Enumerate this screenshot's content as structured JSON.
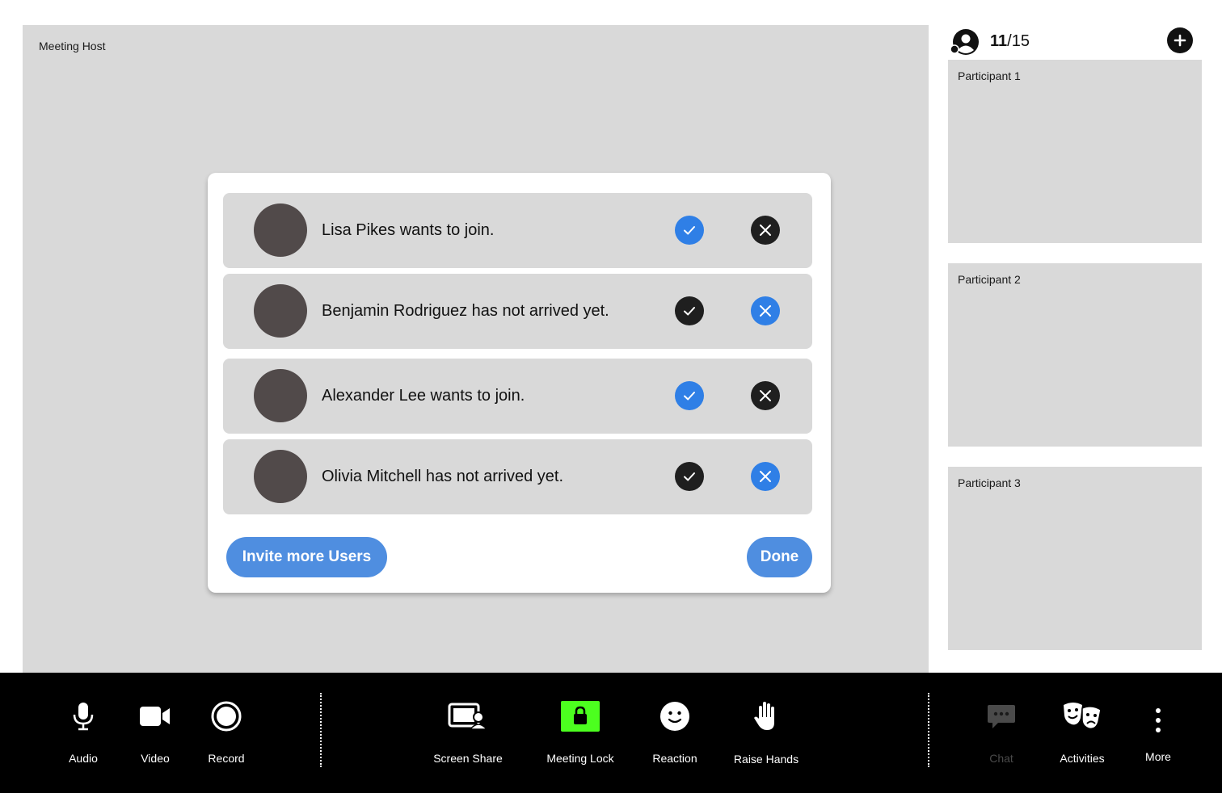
{
  "stage": {
    "host_label": "Meeting Host"
  },
  "requests": [
    {
      "text": "Lisa Pikes wants to join.",
      "accept_state": "active",
      "reject_state": "inactive"
    },
    {
      "text": "Benjamin Rodriguez has not arrived yet.",
      "accept_state": "inactive",
      "reject_state": "active"
    },
    {
      "text": "Alexander Lee wants to join.",
      "accept_state": "active",
      "reject_state": "inactive"
    },
    {
      "text": "Olivia Mitchell has not arrived yet.",
      "accept_state": "inactive",
      "reject_state": "active"
    }
  ],
  "modal": {
    "invite_label": "Invite more Users",
    "done_label": "Done"
  },
  "sidebar": {
    "count_current": "11",
    "count_separator": "/15",
    "tiles": [
      "Participant 1",
      "Participant 2",
      "Participant 3"
    ]
  },
  "toolbar": {
    "audio": "Audio",
    "video": "Video",
    "record": "Record",
    "screen_share": "Screen Share",
    "meeting_lock": "Meeting Lock",
    "reaction": "Reaction",
    "raise_hands": "Raise Hands",
    "chat": "Chat",
    "activities": "Activities",
    "more": "More"
  },
  "colors": {
    "accent_blue": "#2f7fe6",
    "button_blue": "#4f8ee0",
    "lock_green": "#4cff1f",
    "panel_gray": "#d9d9d9"
  }
}
